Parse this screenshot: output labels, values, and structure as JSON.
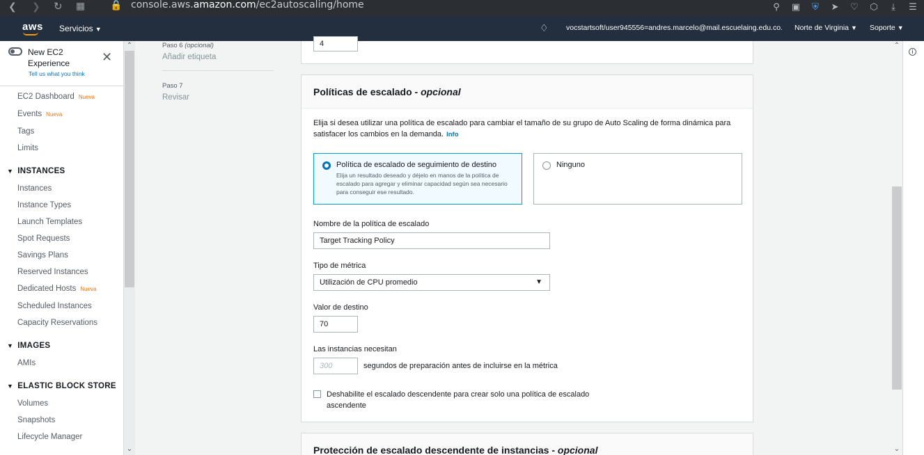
{
  "browser": {
    "url_prefix": "console.aws.",
    "url_domain": "amazon.com",
    "url_path": "/ec2autoscaling/home"
  },
  "header": {
    "logo": "aws",
    "services_label": "Servicios",
    "account": "vocstartsoft/user945556=andres.marcelo@mail.escuelaing.edu.co...",
    "region": "Norte de Virginia",
    "support": "Soporte"
  },
  "sidebar": {
    "experience_title": "New EC2 Experience",
    "experience_link": "Tell us what you think",
    "nueva_badge": "Nueva",
    "top_items": [
      "EC2 Dashboard",
      "Events",
      "Tags",
      "Limits"
    ],
    "sections": [
      {
        "title": "INSTANCES",
        "items": [
          "Instances",
          "Instance Types",
          "Launch Templates",
          "Spot Requests",
          "Savings Plans",
          "Reserved Instances",
          "Dedicated Hosts",
          "Scheduled Instances",
          "Capacity Reservations"
        ]
      },
      {
        "title": "IMAGES",
        "items": [
          "AMIs"
        ]
      },
      {
        "title": "ELASTIC BLOCK STORE",
        "items": [
          "Volumes",
          "Snapshots",
          "Lifecycle Manager"
        ]
      }
    ]
  },
  "steps": {
    "step6_label": "Paso 6",
    "step6_optional": "(opcional)",
    "step6_name": "Añadir etiqueta",
    "step7_label": "Paso 7",
    "step7_name": "Revisar"
  },
  "top_field_value": "4",
  "scaling": {
    "title": "Políticas de escalado - ",
    "title_optional": "opcional",
    "description": "Elija si desea utilizar una política de escalado para cambiar el tamaño de su grupo de Auto Scaling de forma dinámica para satisfacer los cambios en la demanda.",
    "info": "Info",
    "option_target_title": "Política de escalado de seguimiento de destino",
    "option_target_desc": "Elija un resultado deseado y déjelo en manos de la política de escalado para agregar y eliminar capacidad según sea necesario para conseguir ese resultado.",
    "option_none_title": "Ninguno",
    "policy_name_label": "Nombre de la política de escalado",
    "policy_name_value": "Target Tracking Policy",
    "metric_label": "Tipo de métrica",
    "metric_value": "Utilización de CPU promedio",
    "target_label": "Valor de destino",
    "target_value": "70",
    "warmup_label": "Las instancias necesitan",
    "warmup_placeholder": "300",
    "warmup_suffix": "segundos de preparación antes de incluirse en la métrica",
    "disable_scalein_label": "Deshabilite el escalado descendente para crear solo una política de escalado ascendente"
  },
  "protection": {
    "title": "Protección de escalado descendente de instancias - ",
    "title_optional": "opcional"
  },
  "colors": {
    "aws_header": "#232f3e",
    "accent_orange": "#ff9900",
    "link_blue": "#0073bb",
    "selected_border": "#00a1c9"
  }
}
